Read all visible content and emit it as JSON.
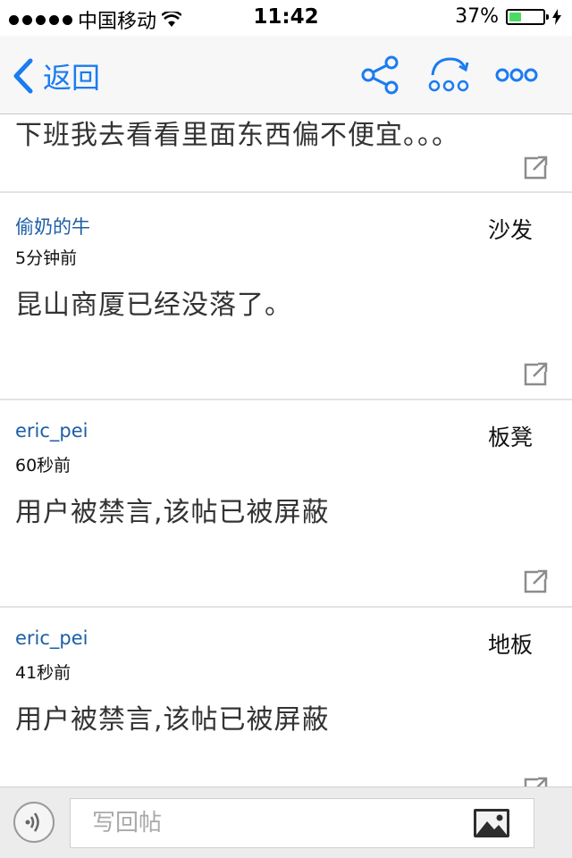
{
  "status_bar": {
    "carrier": "中国移动",
    "time": "11:42",
    "battery": "37%",
    "battery_level": 0.37
  },
  "nav": {
    "back_label": "返回",
    "icons": [
      "share-icon",
      "jump-floor-icon",
      "more-icon"
    ]
  },
  "posts": [
    {
      "author": "",
      "time": "",
      "floor": "",
      "body": "下班我去看看里面东西偏不便宜。。。"
    },
    {
      "author": "偷奶的牛",
      "time": "5分钟前",
      "floor": "沙发",
      "body": "昆山商厦已经没落了。"
    },
    {
      "author": "eric_pei",
      "time": "60秒前",
      "floor": "板凳",
      "body": "用户被禁言,该帖已被屏蔽"
    },
    {
      "author": "eric_pei",
      "time": "41秒前",
      "floor": "地板",
      "body": "用户被禁言,该帖已被屏蔽"
    }
  ],
  "reply_bar": {
    "placeholder": "写回帖"
  },
  "colors": {
    "accent": "#1a7cf1",
    "author": "#1d5ea6",
    "battery": "#4cd964"
  }
}
